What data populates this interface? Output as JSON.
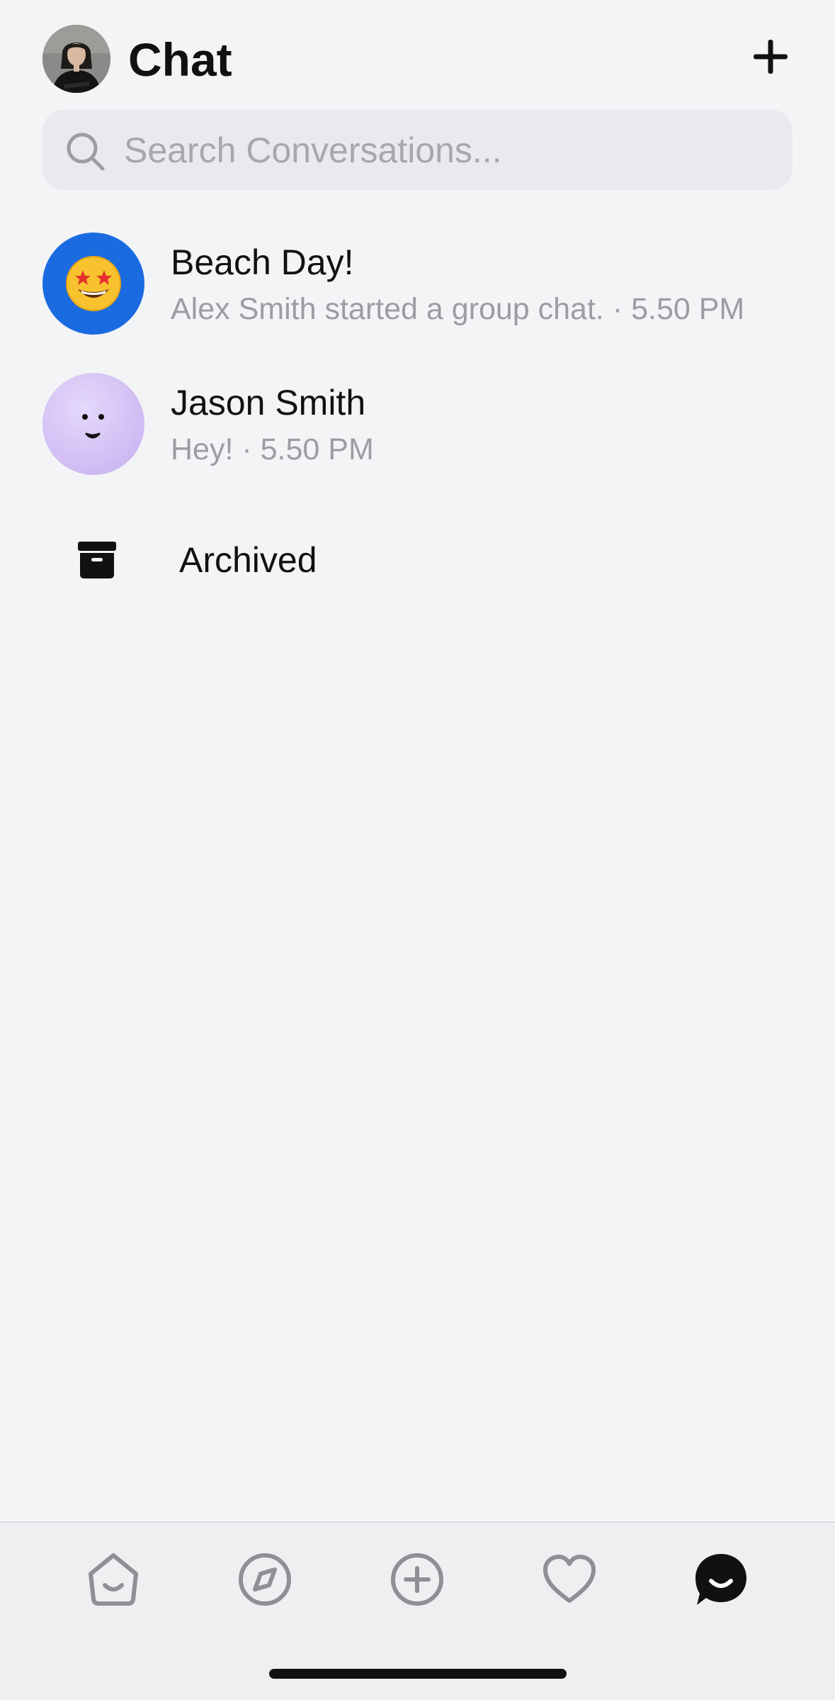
{
  "header": {
    "title": "Chat",
    "profile_avatar_icon": "user-photo-avatar",
    "new_chat_icon": "plus-icon"
  },
  "search": {
    "placeholder": "Search Conversations..."
  },
  "conversations": [
    {
      "name": "Beach Day!",
      "preview": "Alex Smith started a group chat. · 5.50 PM",
      "avatar_icon": "star-struck-emoji",
      "avatar_color": "#1a6be0"
    },
    {
      "name": "Jason Smith",
      "preview": "Hey! · 5.50 PM",
      "avatar_icon": "smiley-face-avatar",
      "avatar_color": "#d6c4f6"
    }
  ],
  "archived": {
    "label": "Archived",
    "icon": "archive-box-icon"
  },
  "tab_bar": {
    "tabs": [
      {
        "name": "home",
        "icon": "home-icon",
        "active": false
      },
      {
        "name": "explore",
        "icon": "compass-icon",
        "active": false
      },
      {
        "name": "create",
        "icon": "plus-circle-icon",
        "active": false
      },
      {
        "name": "favorites",
        "icon": "heart-icon",
        "active": false
      },
      {
        "name": "chat",
        "icon": "chat-bubble-icon",
        "active": true
      }
    ],
    "active_color": "#111111",
    "inactive_color": "#8e9095"
  }
}
